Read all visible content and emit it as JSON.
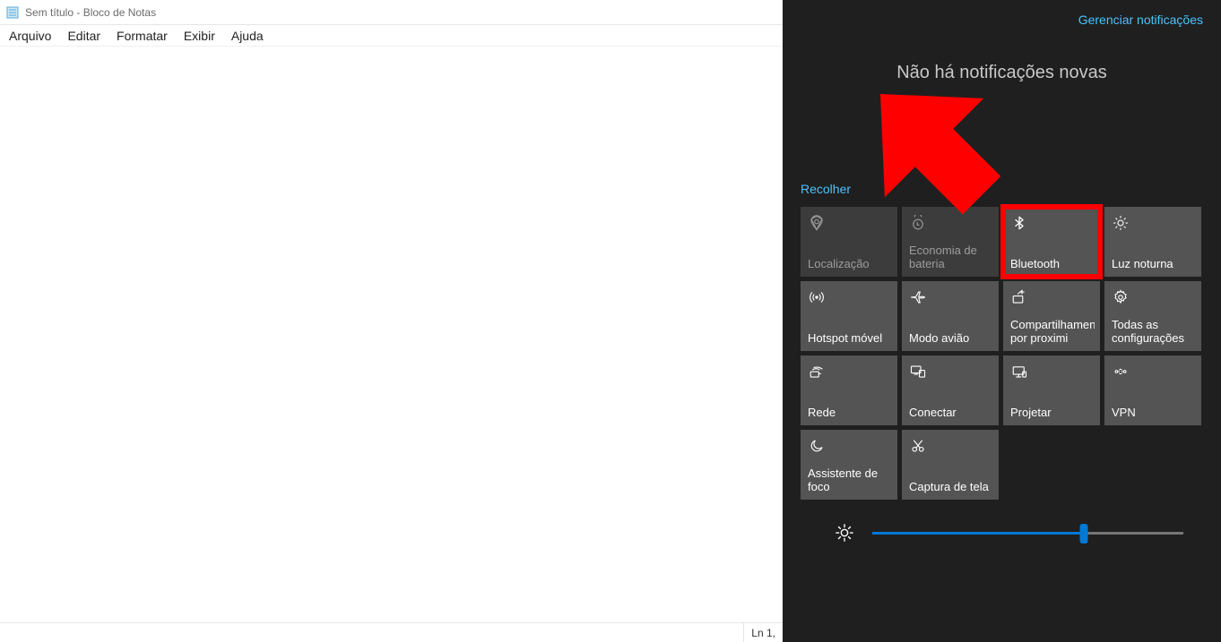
{
  "notepad": {
    "title": "Sem título - Bloco de Notas",
    "menus": [
      "Arquivo",
      "Editar",
      "Formatar",
      "Exibir",
      "Ajuda"
    ],
    "status_cursor": "Ln 1,"
  },
  "action_center": {
    "manage_link": "Gerenciar notificações",
    "no_notifications": "Não há notificações novas",
    "collapse": "Recolher",
    "brightness_percent": 68,
    "tiles": [
      {
        "icon": "location",
        "label": "Localização",
        "disabled": true,
        "highlight": false
      },
      {
        "icon": "battery",
        "label": "Economia de bateria",
        "disabled": true,
        "highlight": false
      },
      {
        "icon": "bluetooth",
        "label": "Bluetooth",
        "disabled": false,
        "highlight": true
      },
      {
        "icon": "nightlight",
        "label": "Luz noturna",
        "disabled": false,
        "highlight": false
      },
      {
        "icon": "hotspot",
        "label": "Hotspot móvel",
        "disabled": false,
        "highlight": false
      },
      {
        "icon": "airplane",
        "label": "Modo avião",
        "disabled": false,
        "highlight": false
      },
      {
        "icon": "nearby",
        "label": "Compartilhamento por proximi",
        "disabled": false,
        "highlight": false
      },
      {
        "icon": "settings",
        "label": "Todas as configurações",
        "disabled": false,
        "highlight": false
      },
      {
        "icon": "network",
        "label": "Rede",
        "disabled": false,
        "highlight": false
      },
      {
        "icon": "connect",
        "label": "Conectar",
        "disabled": false,
        "highlight": false
      },
      {
        "icon": "project",
        "label": "Projetar",
        "disabled": false,
        "highlight": false
      },
      {
        "icon": "vpn",
        "label": "VPN",
        "disabled": false,
        "highlight": false
      },
      {
        "icon": "focus",
        "label": "Assistente de foco",
        "disabled": false,
        "highlight": false
      },
      {
        "icon": "snip",
        "label": "Captura de tela",
        "disabled": false,
        "highlight": false
      }
    ]
  }
}
